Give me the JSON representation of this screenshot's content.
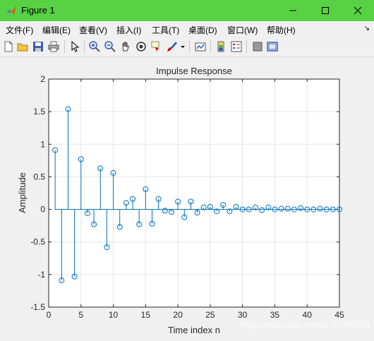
{
  "window": {
    "title": "Figure 1"
  },
  "menu": {
    "items": [
      "文件(F)",
      "编辑(E)",
      "查看(V)",
      "插入(I)",
      "工具(T)",
      "桌面(D)",
      "窗口(W)",
      "帮助(H)"
    ]
  },
  "toolbar": {
    "icons": [
      "new-figure-icon",
      "open-file-icon",
      "save-icon",
      "print-icon",
      "edit-plot-icon",
      "zoom-in-icon",
      "zoom-out-icon",
      "pan-icon",
      "rotate-icon",
      "data-cursor-icon",
      "brush-icon",
      "link-plot-icon",
      "colorbar-icon",
      "legend-icon",
      "hide-plot-tools-icon",
      "show-plot-tools-icon"
    ]
  },
  "chart_data": {
    "type": "stem",
    "title": "Impulse Response",
    "xlabel": "Time index n",
    "ylabel": "Amplitude",
    "xlim": [
      0,
      45
    ],
    "ylim": [
      -1.5,
      2
    ],
    "xticks": [
      "0",
      "5",
      "10",
      "15",
      "20",
      "25",
      "30",
      "35",
      "40",
      "45"
    ],
    "yticks": [
      "-1.5",
      "-1",
      "-0.5",
      "0",
      "0.5",
      "1",
      "1.5",
      "2"
    ],
    "grid": true,
    "color": "#0072bd",
    "x": [
      1,
      2,
      3,
      4,
      5,
      6,
      7,
      8,
      9,
      10,
      11,
      12,
      13,
      14,
      15,
      16,
      17,
      18,
      19,
      20,
      21,
      22,
      23,
      24,
      25,
      26,
      27,
      28,
      29,
      30,
      31,
      32,
      33,
      34,
      35,
      36,
      37,
      38,
      39,
      40,
      41,
      42,
      43,
      44,
      45
    ],
    "y": [
      0.91,
      -1.09,
      1.54,
      -1.03,
      0.77,
      -0.06,
      -0.23,
      0.63,
      -0.58,
      0.56,
      -0.27,
      0.1,
      0.16,
      -0.23,
      0.31,
      -0.22,
      0.16,
      -0.02,
      -0.04,
      0.12,
      -0.12,
      0.12,
      -0.05,
      0.03,
      0.04,
      -0.03,
      0.07,
      -0.03,
      0.04,
      0.0,
      0.0,
      0.03,
      -0.01,
      0.03,
      0.0,
      0.01,
      0.01,
      0.0,
      0.02,
      0.0,
      0.0,
      0.01,
      0.0,
      0.0,
      0.0
    ]
  },
  "watermark": "https://blog.csdn.net/qq_37369201",
  "colors": {
    "titlebar": "#58d144",
    "plot": "#0072bd"
  }
}
